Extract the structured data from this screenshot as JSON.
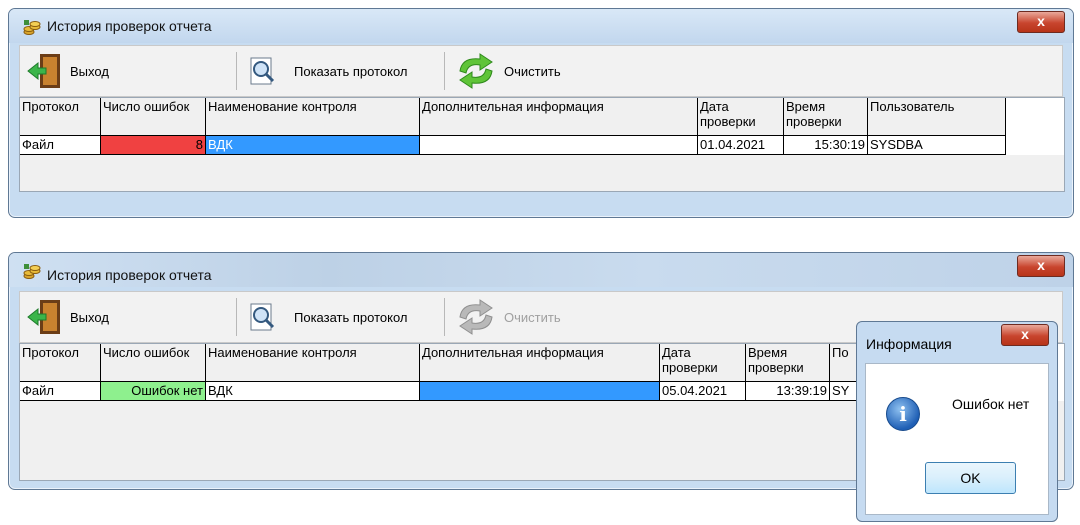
{
  "top": {
    "title": "История проверок отчета",
    "close": "x",
    "toolbar": {
      "exit": "Выход",
      "protocol": "Показать протокол",
      "clear": "Очистить"
    },
    "headers": [
      "Протокол",
      "Число ошибок",
      "Наименование контроля",
      "Дополнительная информация",
      "Дата проверки",
      "Время проверки",
      "Пользователь"
    ],
    "row": {
      "protocol": "Файл",
      "errors": "8",
      "control": "ВДК",
      "info": "",
      "date": "01.04.2021",
      "time": "15:30:19",
      "user": "SYSDBA"
    }
  },
  "bottom": {
    "title": "История проверок отчета",
    "close": "x",
    "toolbar": {
      "exit": "Выход",
      "protocol": "Показать протокол",
      "clear": "Очистить"
    },
    "headers": [
      "Протокол",
      "Число ошибок",
      "Наименование контроля",
      "Дополнительная информация",
      "Дата проверки",
      "Время проверки",
      "По"
    ],
    "row": {
      "protocol": "Файл",
      "errors": "Ошибок нет",
      "control": "ВДК",
      "info": "",
      "date": "05.04.2021",
      "time": "13:39:19",
      "user": "SY"
    }
  },
  "dialog": {
    "title": "Информация",
    "close": "x",
    "message": "Ошибок нет",
    "ok": "OK"
  },
  "colors": {
    "error_cell": "#f04141",
    "ok_cell": "#8ef08e",
    "selected": "#3399ff"
  },
  "icons": {
    "exit": "door-exit-icon",
    "protocol": "magnifier-document-icon",
    "clear": "refresh-arrows-icon",
    "app": "coins-icon",
    "info": "info-icon"
  }
}
